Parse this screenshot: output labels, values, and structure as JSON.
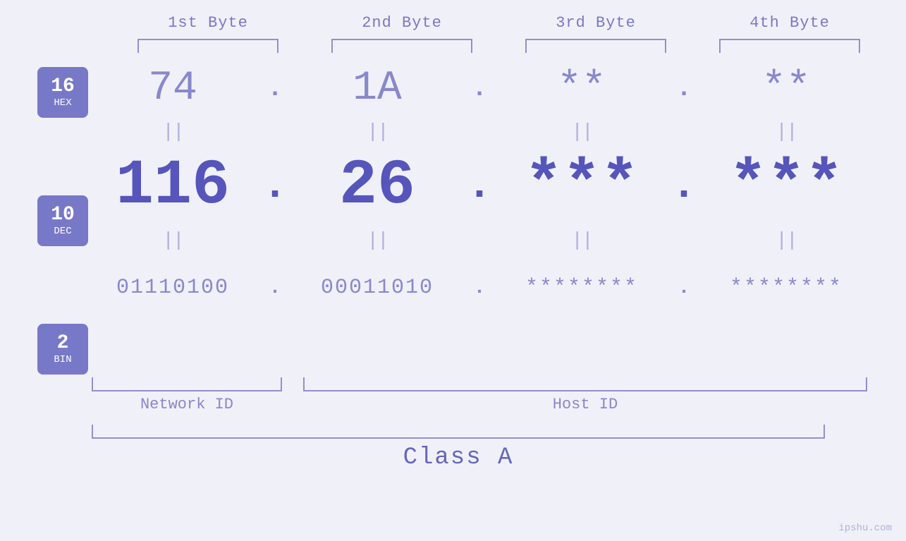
{
  "headers": {
    "col1": "1st Byte",
    "col2": "2nd Byte",
    "col3": "3rd Byte",
    "col4": "4th Byte"
  },
  "bases": {
    "hex": {
      "number": "16",
      "label": "HEX"
    },
    "dec": {
      "number": "10",
      "label": "DEC"
    },
    "bin": {
      "number": "2",
      "label": "BIN"
    }
  },
  "hex_values": {
    "col1": "74",
    "col2": "1A",
    "col3": "**",
    "col4": "**",
    "dot": "."
  },
  "dec_values": {
    "col1": "116",
    "col2": "26",
    "col3": "***",
    "col4": "***",
    "dot": "."
  },
  "bin_values": {
    "col1": "01110100",
    "col2": "00011010",
    "col3": "********",
    "col4": "********",
    "dot": "."
  },
  "labels": {
    "network_id": "Network ID",
    "host_id": "Host ID",
    "class_a": "Class A"
  },
  "watermark": "ipshu.com"
}
